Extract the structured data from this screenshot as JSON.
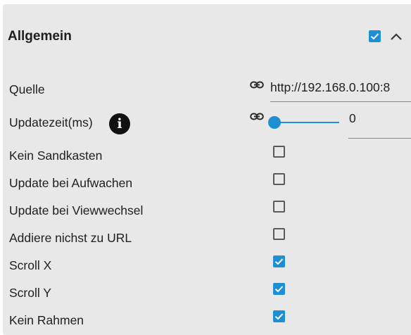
{
  "section": {
    "title": "Allgemein",
    "checked": true
  },
  "fields": {
    "source": {
      "label": "Quelle",
      "value": "http://192.168.0.100:8"
    },
    "update_time": {
      "label": "Updatezeit(ms)",
      "value": "0",
      "slider_fraction": 0
    },
    "no_sandbox": {
      "label": "Kein Sandkasten",
      "checked": false
    },
    "update_on_wake": {
      "label": "Update bei Aufwachen",
      "checked": false
    },
    "update_on_view_change": {
      "label": "Update bei Viewwechsel",
      "checked": false
    },
    "no_append_url": {
      "label": "Addiere nichst zu URL",
      "checked": false
    },
    "scroll_x": {
      "label": "Scroll X",
      "checked": true
    },
    "scroll_y": {
      "label": "Scroll Y",
      "checked": true
    },
    "no_frame": {
      "label": "Kein Rahmen",
      "checked": true
    }
  },
  "colors": {
    "accent": "#1e8fd4",
    "panel_bg": "#e8e8e8"
  },
  "icons": [
    "info-icon",
    "link-icon",
    "chevron-up-icon",
    "checkbox-checked-icon"
  ]
}
